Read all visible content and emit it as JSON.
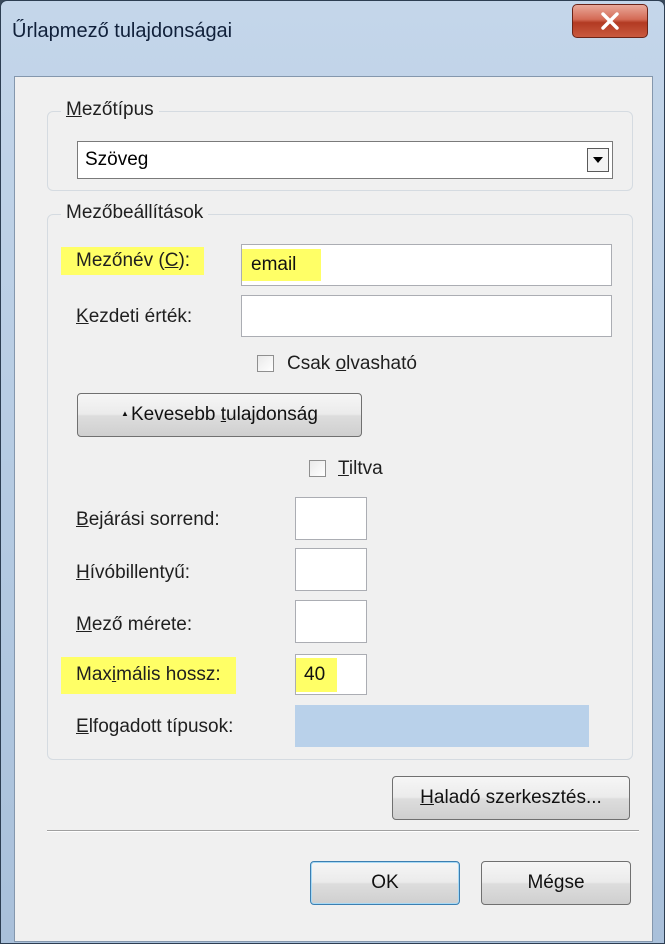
{
  "window": {
    "title": "Űrlapmező tulajdonságai"
  },
  "field_type_group": {
    "legend_pre": "",
    "legend_u": "M",
    "legend_post": "ezőtípus",
    "selected": "Szöveg"
  },
  "settings_group": {
    "legend": "Mezőbeállítások",
    "name_label_pre": "Mezőnév (",
    "name_label_u": "C",
    "name_label_post": "):",
    "name_value": "email",
    "initial_label_u": "K",
    "initial_label_post": "ezdeti érték:",
    "initial_value": "",
    "readonly_pre": "Csak ",
    "readonly_u": "o",
    "readonly_post": "lvasható",
    "less_button_arrow": "▲",
    "less_button_pre": "Kevesebb ",
    "less_button_u": "t",
    "less_button_post": "ulajdonság",
    "disabled_u": "T",
    "disabled_post": "iltva",
    "tab_order_label_u": "B",
    "tab_order_label_post": "ejárási sorrend:",
    "tab_order_value": "",
    "hotkey_label_u": "H",
    "hotkey_label_post": "ívóbillentyű:",
    "hotkey_value": "",
    "size_label_u": "M",
    "size_label_post": "ező mérete:",
    "size_value": "",
    "maxlen_label_pre": "Max",
    "maxlen_label_u": "i",
    "maxlen_label_post": "mális hossz:",
    "maxlen_value": "40",
    "accepted_label_u": "E",
    "accepted_label_post": "lfogadott típusok:",
    "accepted_value": ""
  },
  "buttons": {
    "advanced_u": "H",
    "advanced_post": "aladó szerkesztés...",
    "ok": "OK",
    "cancel": "Mégse"
  },
  "colors": {
    "highlight": "#ffff66",
    "accepted_types_fill": "#b9d1ea"
  }
}
